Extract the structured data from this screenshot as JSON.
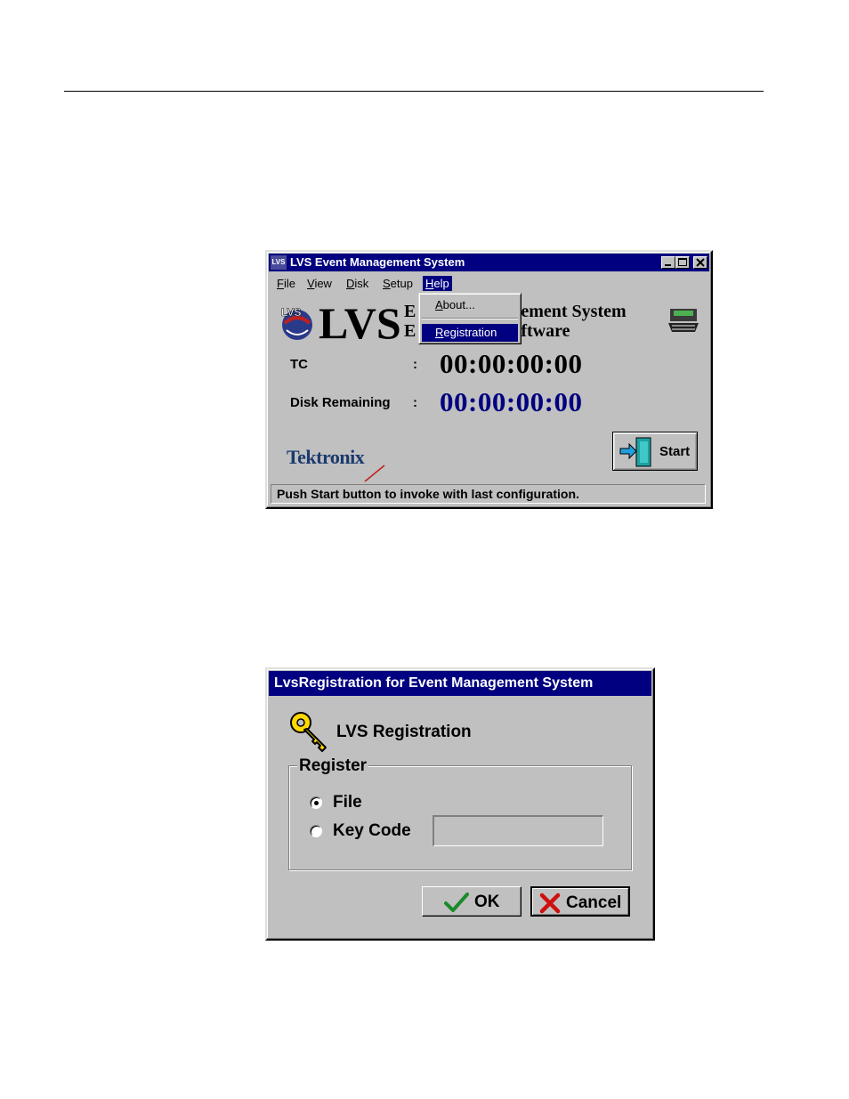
{
  "main_window": {
    "title": "LVS Event Management System",
    "title_icon_text": "LVS",
    "menu": [
      {
        "label": "File",
        "underline": "F",
        "rest": "ile"
      },
      {
        "label": "View",
        "underline": "V",
        "rest": "iew"
      },
      {
        "label": "Disk",
        "underline": "D",
        "rest": "isk"
      },
      {
        "label": "Setup",
        "underline": "S",
        "rest": "etup"
      },
      {
        "label": "Help",
        "underline": "H",
        "rest": "elp"
      }
    ],
    "help_menu": {
      "about": {
        "underline": "A",
        "rest": "bout..."
      },
      "registration": {
        "underline": "R",
        "rest": "egistration"
      }
    },
    "logo_text": "LVS",
    "subtitle_line1_left": "E",
    "subtitle_line1_right": "ement System",
    "subtitle_line2_left": "E",
    "subtitle_line2_right": "ftware",
    "tc_label": "TC",
    "tc_colon": ":",
    "tc_value": "00:00:00:00",
    "disk_label": "Disk Remaining",
    "disk_colon": ":",
    "disk_value": "00:00:00:00",
    "brand": "Tektronix",
    "start_label": "Start",
    "status_text": "Push Start button to invoke with last configuration.",
    "colors": {
      "titlebar": "#000080",
      "disk_value": "#000080",
      "tc_value": "#000000"
    }
  },
  "registration_dialog": {
    "title": "LvsRegistration for Event Management System",
    "heading": "LVS Registration",
    "group_label": "Register",
    "options": [
      {
        "label": "File",
        "selected": true
      },
      {
        "label": "Key Code",
        "selected": false
      }
    ],
    "key_code_value": "",
    "ok_label": "OK",
    "cancel_label": "Cancel"
  }
}
